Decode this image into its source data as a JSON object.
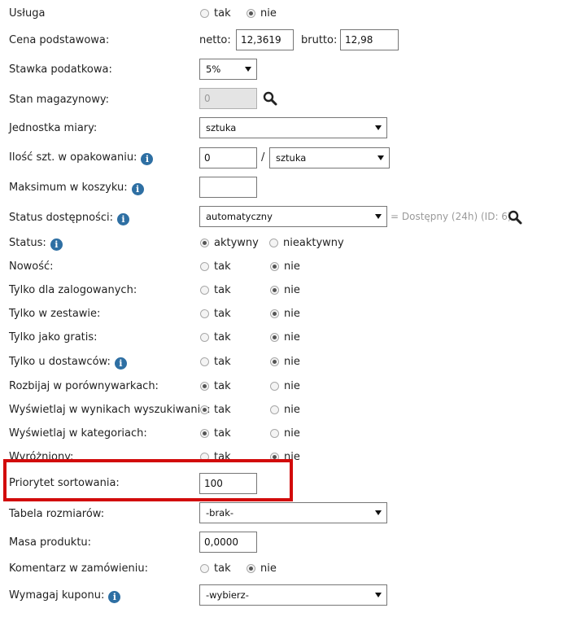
{
  "fields": {
    "usluga": {
      "label": "Usługa",
      "options": [
        "tak",
        "nie"
      ],
      "selected": "nie"
    },
    "cena": {
      "label": "Cena podstawowa:",
      "netto_label": "netto:",
      "netto_value": "12,3619",
      "brutto_label": "brutto:",
      "brutto_value": "12,98"
    },
    "stawka": {
      "label": "Stawka podatkowa:",
      "value": "5%"
    },
    "stan": {
      "label": "Stan magazynowy:",
      "value": "0",
      "icon": "search-icon"
    },
    "jednostka": {
      "label": "Jednostka miary:",
      "value": "sztuka"
    },
    "ilosc": {
      "label": "Ilość szt. w opakowaniu:",
      "value": "0",
      "separator": "/",
      "unit": "sztuka"
    },
    "maksimum": {
      "label": "Maksimum w koszyku:",
      "value": ""
    },
    "status_dostepnosci": {
      "label": "Status dostępności:",
      "value": "automatyczny",
      "hint": "= Dostępny (24h) (ID: 6)",
      "icon": "search-icon"
    },
    "status": {
      "label": "Status:",
      "options": [
        "aktywny",
        "nieaktywny"
      ],
      "selected": "aktywny"
    },
    "nowosc": {
      "label": "Nowość:",
      "options": [
        "tak",
        "nie"
      ],
      "selected": "nie"
    },
    "zalogowani": {
      "label": "Tylko dla zalogowanych:",
      "options": [
        "tak",
        "nie"
      ],
      "selected": "nie"
    },
    "zestaw": {
      "label": "Tylko w zestawie:",
      "options": [
        "tak",
        "nie"
      ],
      "selected": "nie"
    },
    "gratis": {
      "label": "Tylko jako gratis:",
      "options": [
        "tak",
        "nie"
      ],
      "selected": "nie"
    },
    "dostawcy": {
      "label": "Tylko u dostawców:",
      "options": [
        "tak",
        "nie"
      ],
      "selected": "nie"
    },
    "porownywarki": {
      "label": "Rozbijaj w porównywarkach:",
      "options": [
        "tak",
        "nie"
      ],
      "selected": "tak"
    },
    "wyszukiwanie": {
      "label": "Wyświetlaj w wynikach wyszukiwania:",
      "options": [
        "tak",
        "nie"
      ],
      "selected": "tak"
    },
    "kategorie": {
      "label": "Wyświetlaj w kategoriach:",
      "options": [
        "tak",
        "nie"
      ],
      "selected": "tak"
    },
    "wyrozniony": {
      "label": "Wyróżniony:",
      "options": [
        "tak",
        "nie"
      ],
      "selected": "nie"
    },
    "priorytet": {
      "label": "Priorytet sortowania:",
      "value": "100"
    },
    "tabela": {
      "label": "Tabela rozmiarów:",
      "value": "-brak-"
    },
    "masa": {
      "label": "Masa produktu:",
      "value": "0,0000"
    },
    "komentarz": {
      "label": "Komentarz w zamówieniu:",
      "options": [
        "tak",
        "nie"
      ],
      "selected": "nie"
    },
    "kupon": {
      "label": "Wymagaj kuponu:",
      "value": "-wybierz-"
    }
  },
  "info_icon_glyph": "i",
  "colors": {
    "highlight": "#d20b0b",
    "info": "#2e6fa3"
  }
}
